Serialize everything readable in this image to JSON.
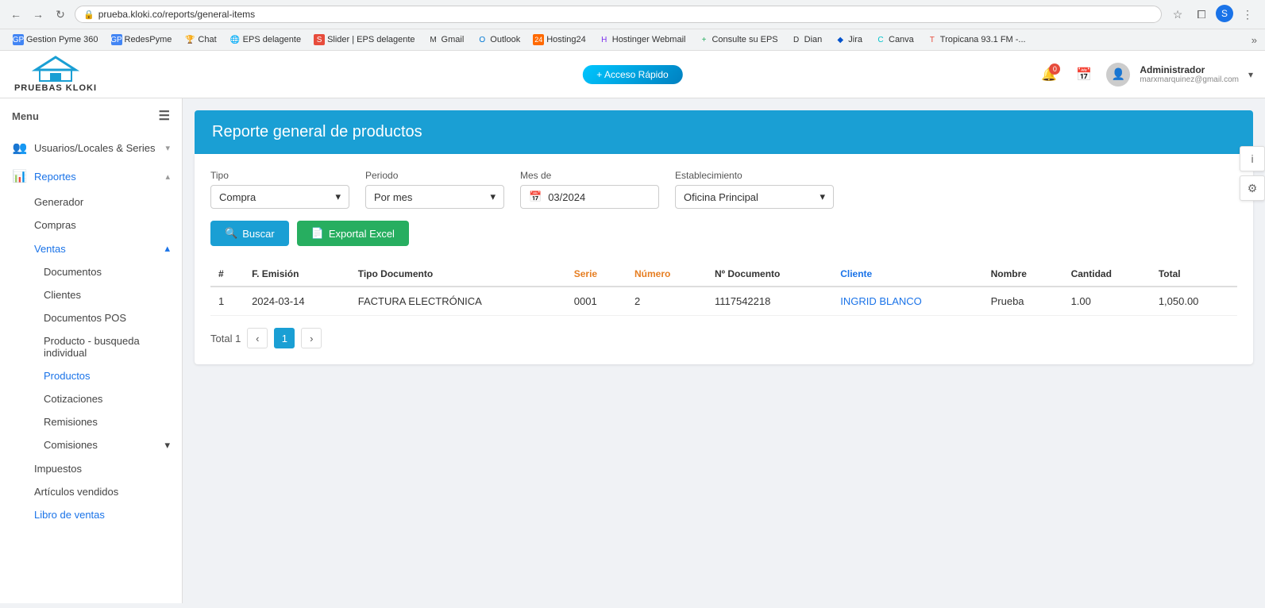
{
  "browser": {
    "url": "prueba.kloki.co/reports/general-items",
    "nav_back": "←",
    "nav_forward": "→",
    "nav_refresh": "↻"
  },
  "bookmarks": [
    {
      "id": "gestion-pyme",
      "label": "Gestion Pyme 360",
      "favicon_color": "#4285f4",
      "icon": "GP"
    },
    {
      "id": "redes-pyme",
      "label": "RedesPyme",
      "favicon_color": "#4285f4",
      "icon": "GP"
    },
    {
      "id": "chat",
      "label": "Chat",
      "favicon_color": "#ffd700",
      "icon": "🏆"
    },
    {
      "id": "eps-delagente",
      "label": "EPS delagente",
      "favicon_color": "#1a73e8",
      "icon": "🌐"
    },
    {
      "id": "slider-eps",
      "label": "Slider | EPS delagente",
      "favicon_color": "#e74c3c",
      "icon": "S"
    },
    {
      "id": "gmail",
      "label": "Gmail",
      "favicon_color": "#ea4335",
      "icon": "M"
    },
    {
      "id": "outlook",
      "label": "Outlook",
      "favicon_color": "#0078d4",
      "icon": "O"
    },
    {
      "id": "hosting24",
      "label": "Hosting24",
      "favicon_color": "#ff6900",
      "icon": "24"
    },
    {
      "id": "hostinger",
      "label": "Hostinger Webmail",
      "favicon_color": "#7b2fed",
      "icon": "H"
    },
    {
      "id": "consulte-eps",
      "label": "Consulte su EPS",
      "favicon_color": "#27ae60",
      "icon": "+"
    },
    {
      "id": "dian",
      "label": "Dian",
      "favicon_color": "#1a73e8",
      "icon": "D"
    },
    {
      "id": "jira",
      "label": "Jira",
      "favicon_color": "#0052cc",
      "icon": "◆"
    },
    {
      "id": "canva",
      "label": "Canva",
      "favicon_color": "#00c4cc",
      "icon": "C"
    },
    {
      "id": "tropicana",
      "label": "Tropicana 93.1 FM -...",
      "favicon_color": "#e74c3c",
      "icon": "T"
    }
  ],
  "header": {
    "logo_text": "PRUEBAS KLOKI",
    "rapid_access_label": "+ Acceso Rápido",
    "notification_count": "0",
    "user_name": "Administrador",
    "user_email": "marxmarquinez@gmail.com"
  },
  "sidebar": {
    "menu_label": "Menu",
    "items": [
      {
        "id": "usuarios",
        "label": "Usuarios/Locales & Series",
        "icon": "👥",
        "arrow": "▾",
        "expanded": false
      },
      {
        "id": "reportes",
        "label": "Reportes",
        "icon": "📊",
        "arrow": "▴",
        "expanded": true,
        "active": true
      },
      {
        "id": "generador",
        "label": "Generador",
        "sub": true
      },
      {
        "id": "compras",
        "label": "Compras",
        "sub": true
      },
      {
        "id": "ventas",
        "label": "Ventas",
        "sub": true,
        "arrow": "▴",
        "expanded": true
      },
      {
        "id": "documentos",
        "label": "Documentos",
        "subsub": true
      },
      {
        "id": "clientes",
        "label": "Clientes",
        "subsub": true
      },
      {
        "id": "documentos-pos",
        "label": "Documentos POS",
        "subsub": true
      },
      {
        "id": "producto-busqueda",
        "label": "Producto - busqueda individual",
        "subsub": true
      },
      {
        "id": "productos",
        "label": "Productos",
        "subsub": true,
        "active": true
      },
      {
        "id": "cotizaciones",
        "label": "Cotizaciones",
        "subsub": true
      },
      {
        "id": "remisiones",
        "label": "Remisiones",
        "subsub": true
      },
      {
        "id": "comisiones",
        "label": "Comisiones",
        "subsub": true,
        "arrow": "▾"
      },
      {
        "id": "impuestos",
        "label": "Impuestos",
        "sub": true
      },
      {
        "id": "articulos-vendidos",
        "label": "Artículos vendidos",
        "sub": true
      },
      {
        "id": "libro-ventas",
        "label": "Libro de ventas",
        "sub": true
      }
    ]
  },
  "page": {
    "title": "Reporte general de productos",
    "filters": {
      "tipo_label": "Tipo",
      "tipo_value": "Compra",
      "periodo_label": "Periodo",
      "periodo_value": "Por mes",
      "mes_label": "Mes de",
      "mes_value": "03/2024",
      "establecimiento_label": "Establecimiento",
      "establecimiento_value": "Oficina Principal"
    },
    "buttons": {
      "search_label": "Buscar",
      "export_label": "Exportal Excel"
    },
    "table": {
      "columns": [
        "#",
        "F. Emisión",
        "Tipo Documento",
        "Serie",
        "Número",
        "Nº Documento",
        "Cliente",
        "Nombre",
        "Cantidad",
        "Total"
      ],
      "rows": [
        {
          "num": "1",
          "fecha": "2024-03-14",
          "tipo_doc": "FACTURA ELECTRÓNICA",
          "serie": "0001",
          "numero": "2",
          "nro_documento": "1117542218",
          "cliente": "INGRID BLANCO",
          "nombre": "Prueba",
          "cantidad": "1.00",
          "total": "1,050.00"
        }
      ]
    },
    "pagination": {
      "total_label": "Total 1",
      "current_page": "1"
    }
  },
  "icons": {
    "search": "🔍",
    "excel": "📄",
    "calendar": "📅",
    "chevron_down": "▾",
    "chevron_up": "▴",
    "chevron_left": "‹",
    "chevron_right": "›",
    "hamburger": "☰",
    "info": "i",
    "settings": "⚙",
    "bell": "🔔"
  }
}
